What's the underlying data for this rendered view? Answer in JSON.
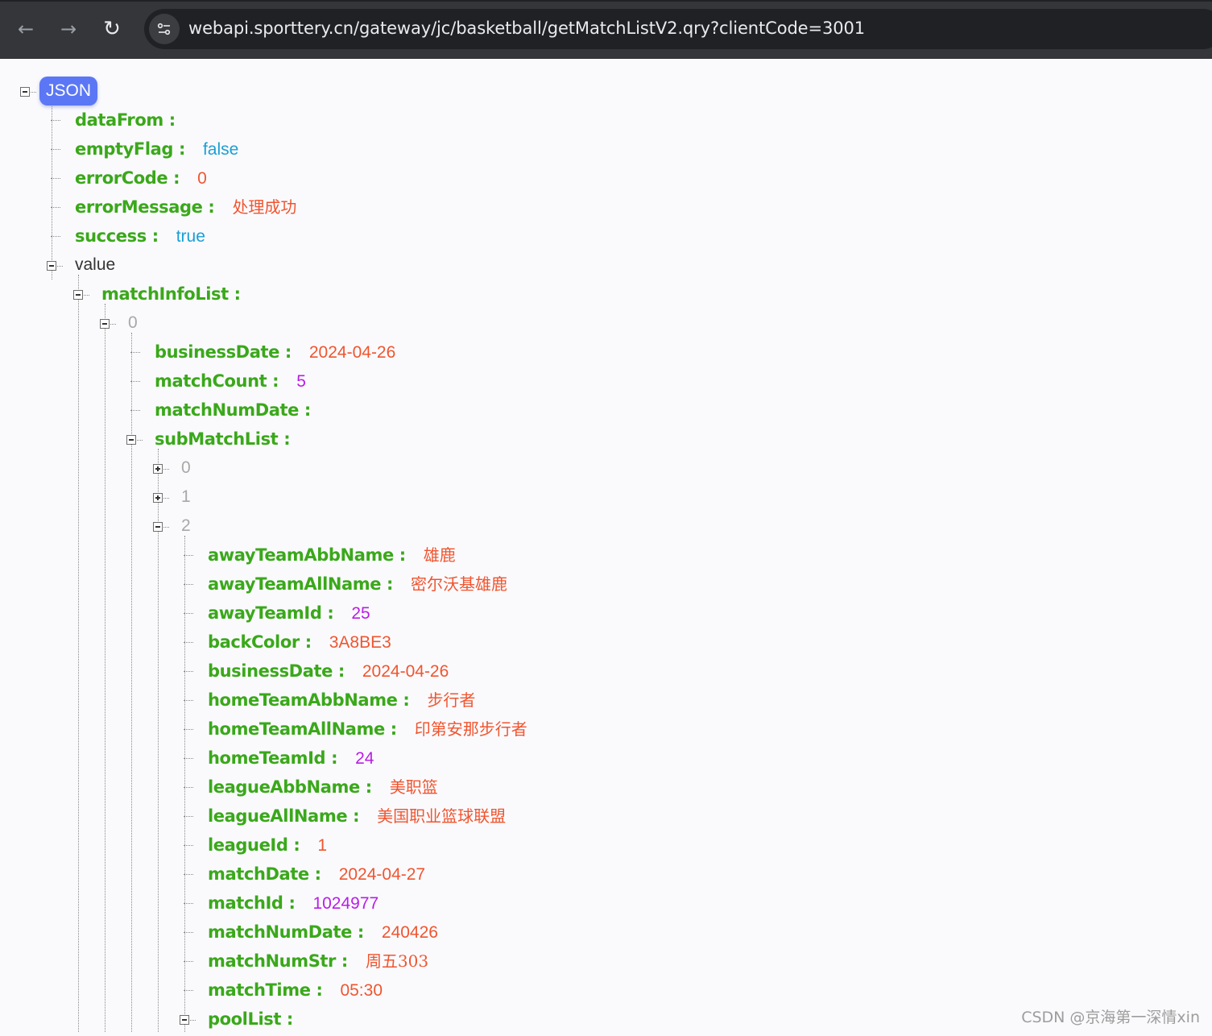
{
  "browser": {
    "url": "webapi.sporttery.cn/gateway/jc/basketball/getMatchListV2.qry?clientCode=3001"
  },
  "tree": {
    "root_label": "JSON",
    "dataFrom_key": "dataFrom :",
    "emptyFlag_key": "emptyFlag :",
    "emptyFlag_val": "false",
    "errorCode_key": "errorCode :",
    "errorCode_val": "0",
    "errorMessage_key": "errorMessage :",
    "errorMessage_val": "处理成功",
    "success_key": "success :",
    "success_val": "true",
    "value_label": "value",
    "matchInfoList_key": "matchInfoList :",
    "idx_0": "0",
    "businessDate_key": "businessDate :",
    "businessDate_val": "2024-04-26",
    "matchCount_key": "matchCount :",
    "matchCount_val": "5",
    "matchNumDate_key": "matchNumDate :",
    "subMatchList_key": "subMatchList :",
    "sub_idx_0": "0",
    "sub_idx_1": "1",
    "sub_idx_2": "2",
    "fields": [
      {
        "key": "awayTeamAbbName :",
        "val": "雄鹿"
      },
      {
        "key": "awayTeamAllName :",
        "val": "密尔沃基雄鹿"
      },
      {
        "key": "awayTeamId :",
        "val": "25"
      },
      {
        "key": "backColor :",
        "val": "3A8BE3"
      },
      {
        "key": "businessDate :",
        "val": "2024-04-26"
      },
      {
        "key": "homeTeamAbbName :",
        "val": "步行者"
      },
      {
        "key": "homeTeamAllName :",
        "val": "印第安那步行者"
      },
      {
        "key": "homeTeamId :",
        "val": "24"
      },
      {
        "key": "leagueAbbName :",
        "val": "美职篮"
      },
      {
        "key": "leagueAllName :",
        "val": "美国职业篮球联盟"
      },
      {
        "key": "leagueId :",
        "val": "1"
      },
      {
        "key": "matchDate :",
        "val": "2024-04-27"
      },
      {
        "key": "matchId :",
        "val": "1024977"
      },
      {
        "key": "matchNumDate :",
        "val": "240426"
      },
      {
        "key": "matchNumStr :",
        "val": "周五303"
      },
      {
        "key": "matchTime :",
        "val": "05:30"
      }
    ],
    "poolList_key": "poolList :"
  },
  "watermark": "CSDN @京海第一深情xin",
  "colors": {
    "key": "#3aa81a",
    "string": "#f0552f",
    "boolean": "#1a9fd4",
    "number": "#b91de6",
    "badge": "#5b77f5"
  }
}
